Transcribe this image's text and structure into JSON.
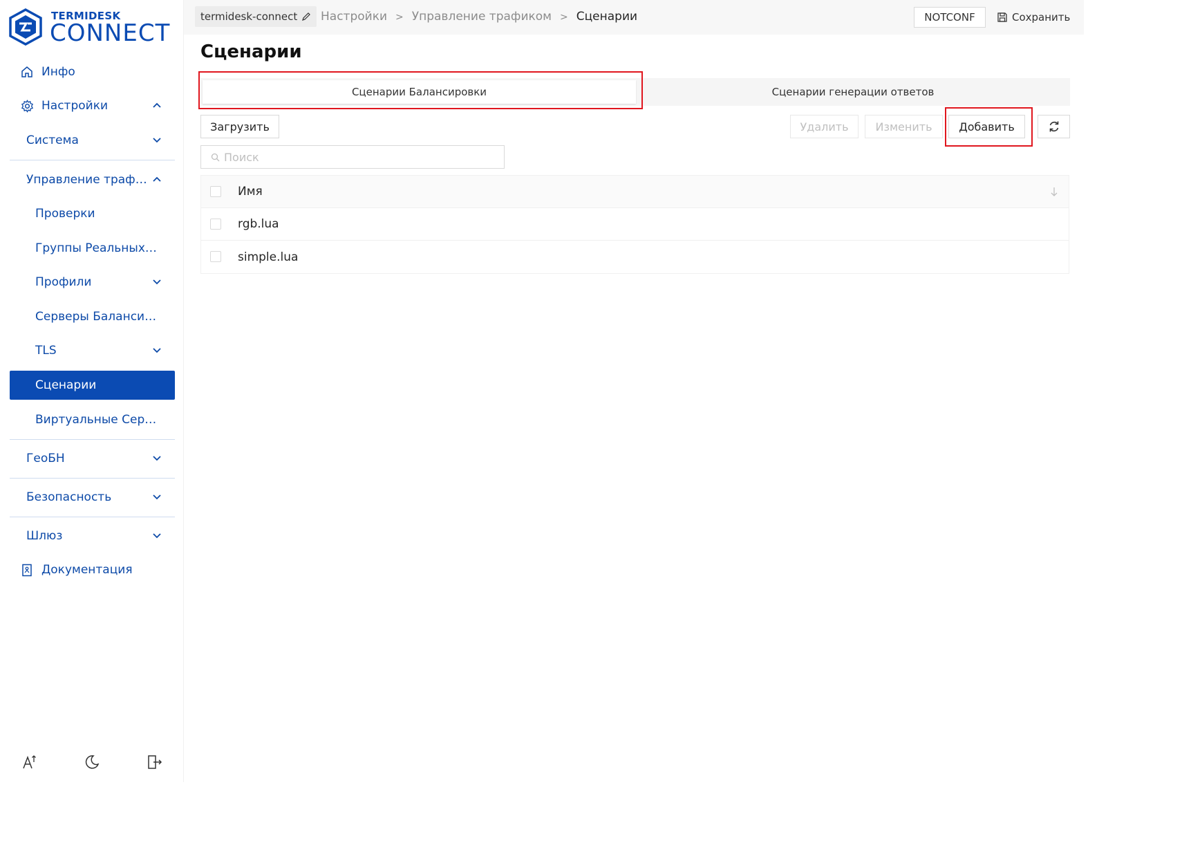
{
  "brand": {
    "line1": "TERMIDESK",
    "line2": "CONNECT",
    "color": "#0b4bb3"
  },
  "sidebar": {
    "info": "Инфо",
    "settings": "Настройки",
    "system": "Система",
    "traffic": "Управление трафи…",
    "checks": "Проверки",
    "real_groups": "Группы Реальных С…",
    "profiles": "Профили",
    "lb_servers": "Серверы Балансир…",
    "tls": "TLS",
    "scenarios": "Сценарии",
    "virtual_servers": "Виртуальные Серве…",
    "geo": "ГеоБН",
    "security": "Безопасность",
    "gateway": "Шлюз",
    "docs": "Документация",
    "active_color": "#0b4bb3"
  },
  "header": {
    "host": "termidesk-connect",
    "crumb1": "Настройки",
    "crumb2": "Управление трафиком",
    "crumb3": "Сценарии",
    "sep": ">",
    "notconf": "NOTCONF",
    "save": "Сохранить"
  },
  "page": {
    "title": "Сценарии",
    "tab_balance": "Сценарии Балансировки",
    "tab_responses": "Сценарии генерации ответов",
    "btn_upload": "Загрузить",
    "btn_delete": "Удалить",
    "btn_edit": "Изменить",
    "btn_add": "Добавить",
    "search_placeholder": "Поиск"
  },
  "table": {
    "col_name": "Имя",
    "rows": [
      "rgb.lua",
      "simple.lua"
    ]
  }
}
